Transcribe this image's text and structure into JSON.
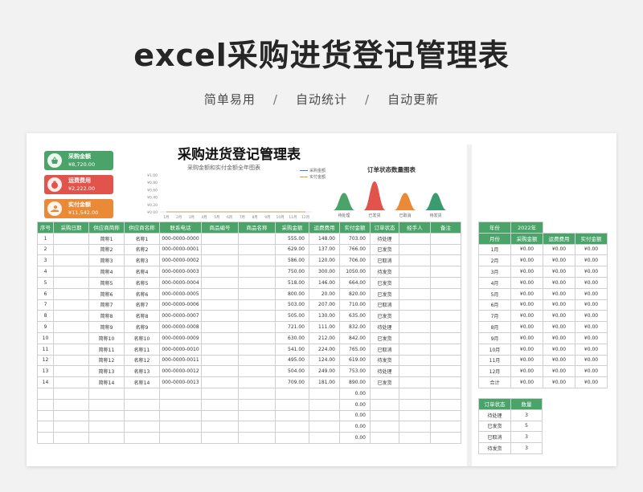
{
  "hero": {
    "title": "excel采购进货登记管理表",
    "subtitle_1": "简单易用",
    "subtitle_2": "自动统计",
    "subtitle_3": "自动更新",
    "separator": "/"
  },
  "kpis": [
    {
      "label": "采购金额",
      "value": "¥8,720.00",
      "icon": "basket-icon"
    },
    {
      "label": "运费费用",
      "value": "¥2,222.00",
      "icon": "money-bag-icon"
    },
    {
      "label": "实付金额",
      "value": "¥11,542.00",
      "icon": "hand-coin-icon"
    }
  ],
  "sheet_title": "采购进货登记管理表",
  "line_chart": {
    "type": "line",
    "title": "采购金额和实付金额全年图表",
    "yticks": [
      "¥1.00",
      "¥0.80",
      "¥0.60",
      "¥0.40",
      "¥0.20",
      "¥0.00"
    ],
    "categories": [
      "1月",
      "2月",
      "3月",
      "4月",
      "5月",
      "6月",
      "7月",
      "8月",
      "9月",
      "10月",
      "11月",
      "12月"
    ],
    "series": [
      {
        "name": "采购金额",
        "values": [
          0,
          0,
          0,
          0,
          0,
          0,
          0,
          0,
          0,
          0,
          0,
          0
        ],
        "color": "#4a7bc8"
      },
      {
        "name": "实付金额",
        "values": [
          0,
          0,
          0,
          0,
          0,
          0,
          0,
          0,
          0,
          0,
          0,
          0
        ],
        "color": "#e0a030"
      }
    ],
    "ylim": [
      0,
      1
    ]
  },
  "pie_chart": {
    "title": "订单状态数量图表",
    "items": [
      {
        "label": "待处理",
        "value": 3,
        "color": "#4aa46a"
      },
      {
        "label": "已发货",
        "value": 5,
        "color": "#e0544c"
      },
      {
        "label": "已取消",
        "value": 3,
        "color": "#ea8a36"
      },
      {
        "label": "待发货",
        "value": 3,
        "color": "#3a9a70"
      }
    ]
  },
  "main_table": {
    "headers": [
      "序号",
      "采购日期",
      "供应商简称",
      "供应商名称",
      "联系电话",
      "商品编号",
      "商品名称",
      "采购金额",
      "运费费用",
      "实付金额",
      "订单状态",
      "经手人",
      "备注"
    ],
    "rows": [
      [
        "1",
        "",
        "简称1",
        "名称1",
        "000-0000-0000",
        "",
        "",
        "555.00",
        "148.00",
        "703.00",
        "待处理",
        "",
        ""
      ],
      [
        "2",
        "",
        "简称2",
        "名称2",
        "000-0000-0001",
        "",
        "",
        "629.00",
        "137.00",
        "766.00",
        "已发货",
        "",
        ""
      ],
      [
        "3",
        "",
        "简称3",
        "名称3",
        "000-0000-0002",
        "",
        "",
        "586.00",
        "120.00",
        "706.00",
        "已取消",
        "",
        ""
      ],
      [
        "4",
        "",
        "简称4",
        "名称4",
        "000-0000-0003",
        "",
        "",
        "750.00",
        "300.00",
        "1050.00",
        "待发货",
        "",
        ""
      ],
      [
        "5",
        "",
        "简称5",
        "名称5",
        "000-0000-0004",
        "",
        "",
        "518.00",
        "146.00",
        "664.00",
        "已发货",
        "",
        ""
      ],
      [
        "6",
        "",
        "简称6",
        "名称6",
        "000-0000-0005",
        "",
        "",
        "800.00",
        "20.00",
        "820.00",
        "已发货",
        "",
        ""
      ],
      [
        "7",
        "",
        "简称7",
        "名称7",
        "000-0000-0006",
        "",
        "",
        "503.00",
        "207.00",
        "710.00",
        "已取消",
        "",
        ""
      ],
      [
        "8",
        "",
        "简称8",
        "名称8",
        "000-0000-0007",
        "",
        "",
        "505.00",
        "130.00",
        "635.00",
        "已发货",
        "",
        ""
      ],
      [
        "9",
        "",
        "简称9",
        "名称9",
        "000-0000-0008",
        "",
        "",
        "721.00",
        "111.00",
        "832.00",
        "待处理",
        "",
        ""
      ],
      [
        "10",
        "",
        "简称10",
        "名称10",
        "000-0000-0009",
        "",
        "",
        "630.00",
        "212.00",
        "842.00",
        "已发货",
        "",
        ""
      ],
      [
        "11",
        "",
        "简称11",
        "名称11",
        "000-0000-0010",
        "",
        "",
        "541.00",
        "224.00",
        "765.00",
        "已取消",
        "",
        ""
      ],
      [
        "12",
        "",
        "简称12",
        "名称12",
        "000-0000-0011",
        "",
        "",
        "495.00",
        "124.00",
        "619.00",
        "待发货",
        "",
        ""
      ],
      [
        "13",
        "",
        "简称13",
        "名称13",
        "000-0000-0012",
        "",
        "",
        "504.00",
        "249.00",
        "753.00",
        "待处理",
        "",
        ""
      ],
      [
        "14",
        "",
        "简称14",
        "名称14",
        "000-0000-0013",
        "",
        "",
        "709.00",
        "181.00",
        "890.00",
        "已发货",
        "",
        ""
      ],
      [
        "",
        "",
        "",
        "",
        "",
        "",
        "",
        "",
        "",
        "0.00",
        "",
        "",
        ""
      ],
      [
        "",
        "",
        "",
        "",
        "",
        "",
        "",
        "",
        "",
        "0.00",
        "",
        "",
        ""
      ],
      [
        "",
        "",
        "",
        "",
        "",
        "",
        "",
        "",
        "",
        "0.00",
        "",
        "",
        ""
      ],
      [
        "",
        "",
        "",
        "",
        "",
        "",
        "",
        "",
        "",
        "0.00",
        "",
        "",
        ""
      ],
      [
        "",
        "",
        "",
        "",
        "",
        "",
        "",
        "",
        "",
        "0.00",
        "",
        "",
        ""
      ]
    ]
  },
  "year_table": {
    "year_label": "年份",
    "year_value": "2022年",
    "headers": [
      "月份",
      "采购金额",
      "运费费用",
      "实付金额"
    ],
    "rows": [
      [
        "1月",
        "¥0.00",
        "¥0.00",
        "¥0.00"
      ],
      [
        "2月",
        "¥0.00",
        "¥0.00",
        "¥0.00"
      ],
      [
        "3月",
        "¥0.00",
        "¥0.00",
        "¥0.00"
      ],
      [
        "4月",
        "¥0.00",
        "¥0.00",
        "¥0.00"
      ],
      [
        "5月",
        "¥0.00",
        "¥0.00",
        "¥0.00"
      ],
      [
        "6月",
        "¥0.00",
        "¥0.00",
        "¥0.00"
      ],
      [
        "7月",
        "¥0.00",
        "¥0.00",
        "¥0.00"
      ],
      [
        "8月",
        "¥0.00",
        "¥0.00",
        "¥0.00"
      ],
      [
        "9月",
        "¥0.00",
        "¥0.00",
        "¥0.00"
      ],
      [
        "10月",
        "¥0.00",
        "¥0.00",
        "¥0.00"
      ],
      [
        "11月",
        "¥0.00",
        "¥0.00",
        "¥0.00"
      ],
      [
        "12月",
        "¥0.00",
        "¥0.00",
        "¥0.00"
      ],
      [
        "合计",
        "¥0.00",
        "¥0.00",
        "¥0.00"
      ]
    ]
  },
  "status_table": {
    "headers": [
      "订单状态",
      "数量"
    ],
    "rows": [
      [
        "待处理",
        "3"
      ],
      [
        "已发货",
        "5"
      ],
      [
        "已取消",
        "3"
      ],
      [
        "待发货",
        "3"
      ]
    ]
  },
  "colors": {
    "accent": "#4aa46a",
    "red": "#e0544c",
    "orange": "#ea8a36"
  }
}
